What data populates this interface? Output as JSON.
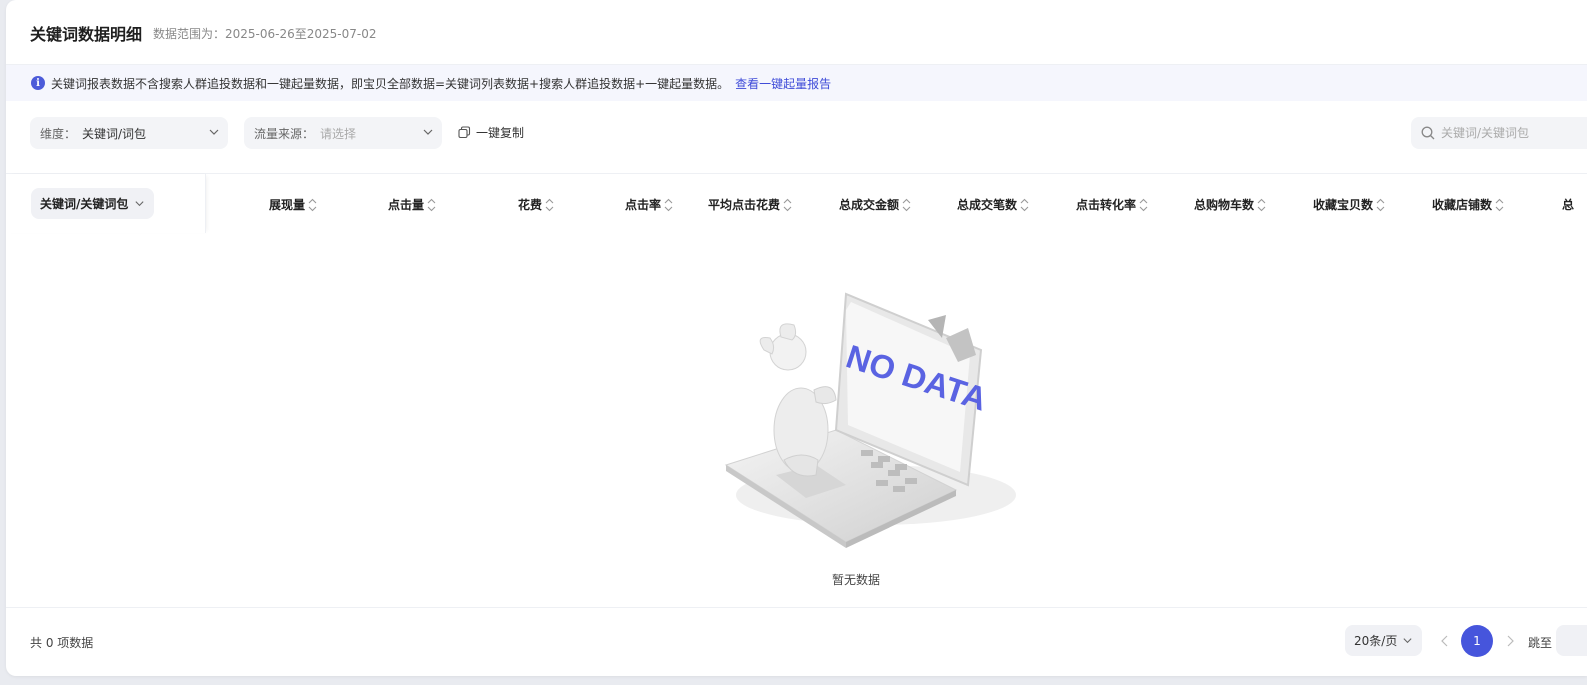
{
  "header": {
    "title": "关键词数据明细",
    "range": "数据范围为：2025-06-26至2025-07-02"
  },
  "notice": {
    "text": "关键词报表数据不含搜索人群追投数据和一键起量数据，即宝贝全部数据=关键词列表数据+搜索人群追投数据+一键起量数据。",
    "link": "查看一键起量报告"
  },
  "filters": {
    "dimension_label": "维度：",
    "dimension_value": "关键词/词包",
    "source_label": "流量来源：",
    "source_placeholder": "请选择",
    "copy_label": "一键复制",
    "search_placeholder": "关键词/关键词包"
  },
  "table": {
    "first_col": "关键词/关键词包",
    "columns": [
      "展现量",
      "点击量",
      "花费",
      "点击率",
      "平均点击花费",
      "总成交金额",
      "总成交笔数",
      "点击转化率",
      "总购物车数",
      "收藏宝贝数",
      "收藏店铺数",
      "总"
    ],
    "empty_text": "暂无数据",
    "illustration_text": "NO DATA"
  },
  "footer": {
    "total": "共 0 项数据",
    "page_size": "20条/页",
    "current_page": "1",
    "jump_label": "跳至"
  },
  "colors": {
    "accent": "#4655dc",
    "link": "#3d4ad8",
    "notice_bg": "#f5f6fd"
  }
}
